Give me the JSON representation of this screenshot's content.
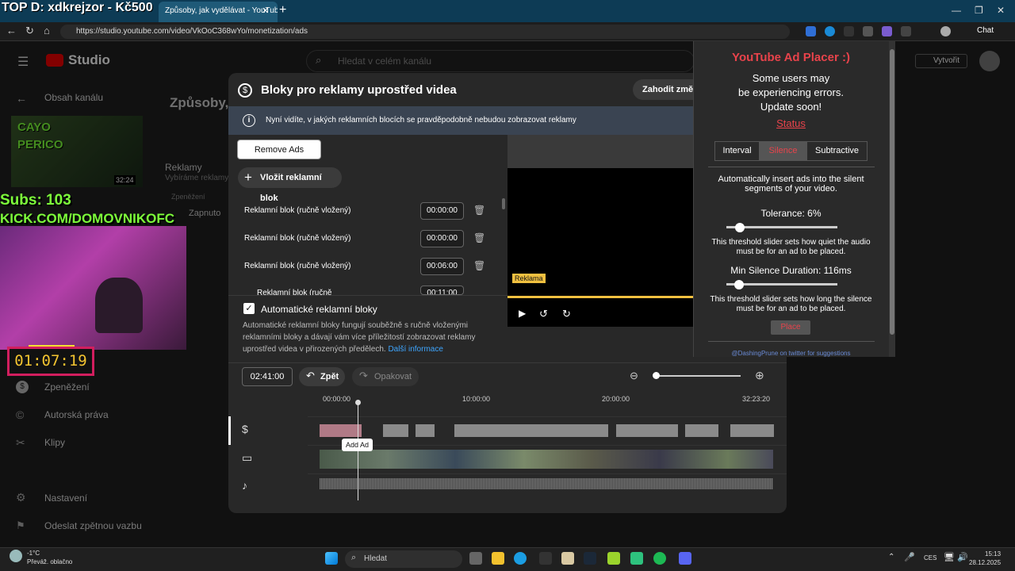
{
  "browser": {
    "tab_inactive_label": "TOP D: xdkrejzor - Kč500",
    "tab_active_label": "Způsoby, jak vydělávat - YouTube",
    "url": "https://studio.youtube.com/video/VkOoC368wYo/monetization/ads",
    "chat_label": "Chat"
  },
  "studio": {
    "logo_text": "Studio",
    "search_placeholder": "Hledat v celém kanálu",
    "create_label": "Vytvořit",
    "back_label": "Obsah kanálu",
    "video_duration": "32:24",
    "page_heading": "Způsoby, j",
    "ads_heading": "Reklamy",
    "ads_sub": "Vybíráme reklamy t",
    "monet_label": "Zpeněžení",
    "enabled_label": "Zapnuto",
    "side_items": [
      "Zpeněžení",
      "Autorská práva",
      "Klipy",
      "Nastavení",
      "Odeslat zpětnou vazbu"
    ]
  },
  "dialog": {
    "title": "Bloky pro reklamy uprostřed videa",
    "discard_label": "Zahodit změn",
    "info_text": "Nyní vidíte, v jakých reklamních blocích se pravděpodobně nebudou zobrazovat reklamy",
    "remove_ads_label": "Remove Ads",
    "insert_block_label": "Vložit reklamní blok",
    "blocks": [
      {
        "label": "Reklamní blok (ručně vložený)",
        "time": "00:00:00"
      },
      {
        "label": "Reklamní blok (ručně vložený)",
        "time": "00:00:00"
      },
      {
        "label": "Reklamní blok (ručně vložený)",
        "time": "00:06:00"
      },
      {
        "label": "Reklamní blok (ručně",
        "time": "00:11:00"
      }
    ],
    "auto_title": "Automatické reklamní bloky",
    "auto_desc": "Automatické reklamní bloky fungují souběžně s ručně vloženými reklamními bloky a dávají vám více příležitostí zobrazovat reklamy uprostřed videa v přirozených předělech.",
    "more_info": "Další informace",
    "preview_tag": "Reklama"
  },
  "timeline": {
    "current_time": "02:41:00",
    "undo_label": "Zpět",
    "redo_label": "Opakovat",
    "ticks": [
      "00:00:00",
      "10:00:00",
      "20:00:00",
      "32:23:20"
    ],
    "add_ad_tooltip": "Add Ad"
  },
  "extension": {
    "title": "YouTube Ad Placer :)",
    "note_lines": [
      "Some users may",
      "be experiencing errors.",
      "Update soon!"
    ],
    "status_link": "Status",
    "tabs": [
      "Interval",
      "Silence",
      "Subtractive"
    ],
    "active_tab": "Silence",
    "desc": "Automatically insert ads into the silent segments of your video.",
    "tolerance_label": "Tolerance: 6%",
    "tolerance_value": 0.06,
    "tolerance_desc": "This threshold slider sets how quiet the audio must be for an ad to be placed.",
    "min_silence_label": "Min Silence Duration: 116ms",
    "min_silence_desc": "This threshold slider sets how long the silence must be for an ad to be placed.",
    "place_label": "Place",
    "footer": "@DashingPrune on twitter for suggestions",
    "accent": "#e8434b"
  },
  "stream": {
    "subs": "Subs: 103",
    "kick": "KICK.COM/DOMOVNIKOFC",
    "timer": "01:07:19",
    "thumb_text": "CAYO PERICO"
  },
  "taskbar": {
    "weather_temp": "-1°C",
    "weather_desc": "Převáž. oblačno",
    "search_label": "Hledat",
    "lang": "CES",
    "time": "15:13",
    "date": "28.12.2025"
  }
}
